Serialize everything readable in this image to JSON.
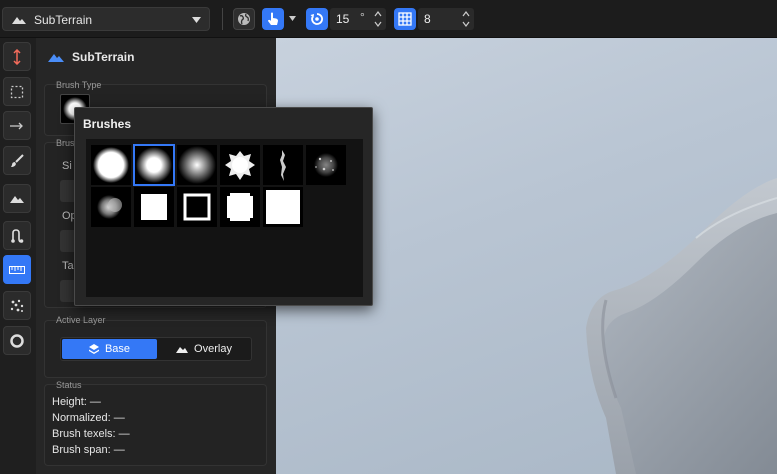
{
  "toolbar": {
    "terrain_name": "SubTerrain",
    "rotation_value": "15",
    "rotation_unit": "°",
    "grid_value": "8"
  },
  "panel": {
    "title": "SubTerrain",
    "brush_type_label": "Brush Type",
    "brush_section_label": "Brus",
    "size_label": "Si",
    "opacity_label": "Op",
    "target_label": "Ta",
    "active_layer_label": "Active Layer",
    "layer_base": "Base",
    "layer_overlay": "Overlay",
    "status_label": "Status",
    "status": {
      "height": "Height: —",
      "normalized": "Normalized: —",
      "brush_texels": "Brush texels: —",
      "brush_span": "Brush span: —"
    }
  },
  "popup": {
    "title": "Brushes",
    "brushes": [
      "soft-circle",
      "soft-circle-selected",
      "radial-gradient",
      "splat",
      "scratch",
      "noise",
      "cloud",
      "square",
      "square-outline",
      "rough-square",
      "large-square"
    ],
    "selected_index": 1
  },
  "colors": {
    "accent": "#3478f6",
    "panel_bg": "#262626"
  }
}
